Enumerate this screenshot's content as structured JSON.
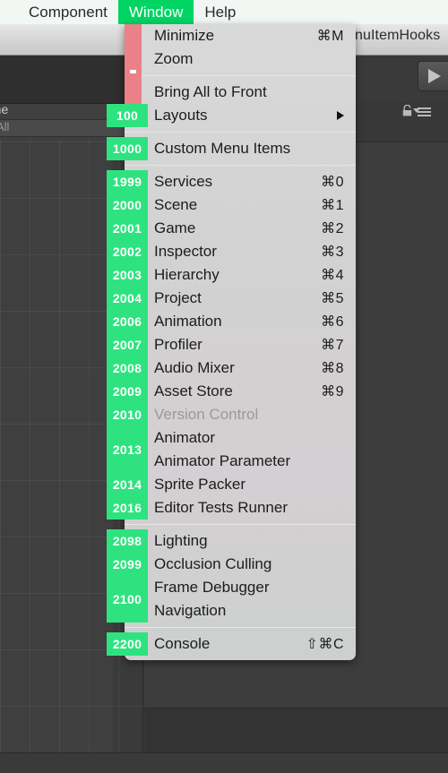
{
  "menubar": {
    "items": [
      {
        "label": "Component",
        "active": false
      },
      {
        "label": "Window",
        "active": true
      },
      {
        "label": "Help",
        "active": false
      }
    ]
  },
  "background": {
    "window_title": "nuItemHooks",
    "field_label": "ame",
    "search_value": "All",
    "icons": {
      "play": "play-icon",
      "lock": "lock-icon",
      "menu": "hamburger-icon",
      "caret": "chevron-down-icon"
    }
  },
  "menu": {
    "name": "Window",
    "highlight_color": "#ea8189",
    "badge_color": "#2ee37f",
    "accent_color": "#00d563",
    "groups": [
      {
        "items": [
          {
            "label": "Minimize",
            "shortcut": "⌘M",
            "badge": null,
            "disabled": false,
            "submenu": false
          },
          {
            "label": "Zoom",
            "shortcut": "",
            "badge": null,
            "disabled": false,
            "submenu": false
          }
        ]
      },
      {
        "items": [
          {
            "label": "Bring All to Front",
            "shortcut": "",
            "badge": null,
            "disabled": false,
            "submenu": false
          },
          {
            "label": "Layouts",
            "shortcut": "",
            "badge": "100",
            "disabled": false,
            "submenu": true
          }
        ]
      },
      {
        "items": [
          {
            "label": "Custom Menu Items",
            "shortcut": "",
            "badge": "1000",
            "disabled": false,
            "submenu": false
          }
        ]
      },
      {
        "items": [
          {
            "label": "Services",
            "shortcut": "⌘0",
            "badge": "1999",
            "disabled": false,
            "submenu": false
          },
          {
            "label": "Scene",
            "shortcut": "⌘1",
            "badge": "2000",
            "disabled": false,
            "submenu": false
          },
          {
            "label": "Game",
            "shortcut": "⌘2",
            "badge": "2001",
            "disabled": false,
            "submenu": false
          },
          {
            "label": "Inspector",
            "shortcut": "⌘3",
            "badge": "2002",
            "disabled": false,
            "submenu": false
          },
          {
            "label": "Hierarchy",
            "shortcut": "⌘4",
            "badge": "2003",
            "disabled": false,
            "submenu": false
          },
          {
            "label": "Project",
            "shortcut": "⌘5",
            "badge": "2004",
            "disabled": false,
            "submenu": false
          },
          {
            "label": "Animation",
            "shortcut": "⌘6",
            "badge": "2006",
            "disabled": false,
            "submenu": false
          },
          {
            "label": "Profiler",
            "shortcut": "⌘7",
            "badge": "2007",
            "disabled": false,
            "submenu": false
          },
          {
            "label": "Audio Mixer",
            "shortcut": "⌘8",
            "badge": "2008",
            "disabled": false,
            "submenu": false
          },
          {
            "label": "Asset Store",
            "shortcut": "⌘9",
            "badge": "2009",
            "disabled": false,
            "submenu": false
          },
          {
            "label": "Version Control",
            "shortcut": "",
            "badge": "2010",
            "disabled": true,
            "submenu": false
          },
          {
            "label": "Animator",
            "shortcut": "",
            "badge": "2013",
            "badge_span": 2,
            "disabled": false,
            "submenu": false
          },
          {
            "label": "Animator Parameter",
            "shortcut": "",
            "badge": null,
            "disabled": false,
            "submenu": false
          },
          {
            "label": "Sprite Packer",
            "shortcut": "",
            "badge": "2014",
            "disabled": false,
            "submenu": false
          },
          {
            "label": "Editor Tests Runner",
            "shortcut": "",
            "badge": "2016",
            "disabled": false,
            "submenu": false
          }
        ]
      },
      {
        "items": [
          {
            "label": "Lighting",
            "shortcut": "",
            "badge": "2098",
            "disabled": false,
            "submenu": false
          },
          {
            "label": "Occlusion Culling",
            "shortcut": "",
            "badge": "2099",
            "disabled": false,
            "submenu": false
          },
          {
            "label": "Frame Debugger",
            "shortcut": "",
            "badge": "2100",
            "badge_span": 2,
            "disabled": false,
            "submenu": false
          },
          {
            "label": "Navigation",
            "shortcut": "",
            "badge": null,
            "disabled": false,
            "submenu": false
          }
        ]
      },
      {
        "items": [
          {
            "label": "Console",
            "shortcut": "⇧⌘C",
            "badge": "2200",
            "disabled": false,
            "submenu": false
          }
        ]
      }
    ]
  }
}
